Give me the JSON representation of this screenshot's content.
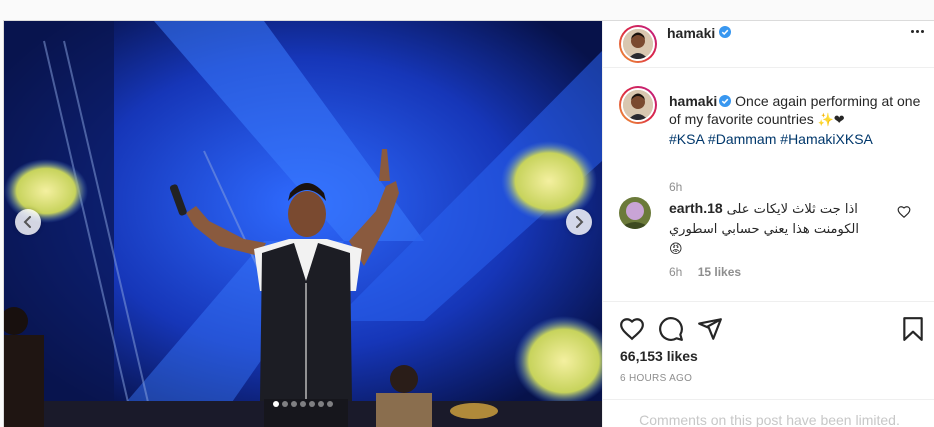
{
  "post": {
    "username": "hamaki",
    "verified": true,
    "caption": {
      "text": "Once again performing at one of my favorite countries",
      "emojis": "✨❤",
      "hashtags": [
        "#KSA",
        "#Dammam",
        "#HamakiXKSA"
      ],
      "time": "6h"
    },
    "comment": {
      "username": "earth.18",
      "line1": "اذا جت ثلاث لايكات على",
      "line2": "الكومنت هذا يعني حسابي اسطوري",
      "emoji": "😡",
      "time": "6h",
      "likes": "15 likes"
    },
    "likes": "66,153 likes",
    "date": "6 HOURS AGO",
    "limited_notice": "Comments on this post have been limited.",
    "carousel": {
      "total_slides": 7,
      "active_index": 0
    }
  },
  "icons": {
    "verified": "verified-badge-icon",
    "more": "more-options-icon",
    "like": "heart-icon",
    "comment": "comment-icon",
    "share": "share-icon",
    "save": "bookmark-icon",
    "prev": "chevron-left-icon",
    "next": "chevron-right-icon"
  },
  "colors": {
    "verified": "#3897f0",
    "hashtag": "#00376b",
    "muted": "#8e8e8e",
    "stage_blue": "#1c3fc9"
  }
}
